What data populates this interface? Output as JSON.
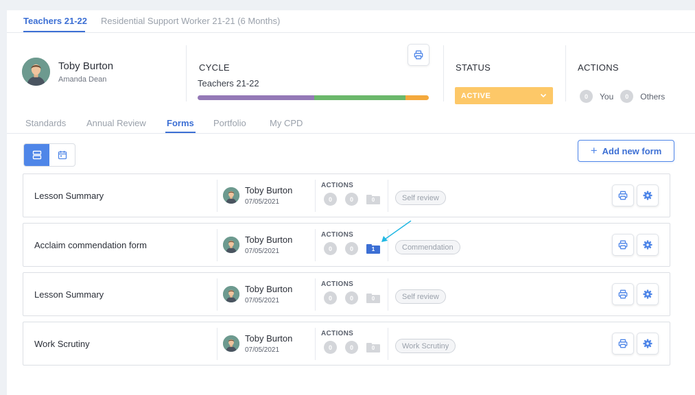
{
  "top_tabs": [
    {
      "label": "Teachers 21-22",
      "active": true
    },
    {
      "label": "Residential Support Worker 21-21 (6 Months)",
      "active": false
    }
  ],
  "profile": {
    "name": "Toby Burton",
    "subtitle": "Amanda Dean"
  },
  "cycle": {
    "label": "CYCLE",
    "value": "Teachers 21-22",
    "progress_segments": [
      {
        "fraction": 0.505,
        "color": "#9479b7"
      },
      {
        "fraction": 0.395,
        "color": "#6bb86b"
      },
      {
        "fraction": 0.1,
        "color": "#f4a93d"
      }
    ]
  },
  "status": {
    "label": "STATUS",
    "value": "ACTIVE",
    "color": "#fdc868"
  },
  "actions": {
    "label": "ACTIONS",
    "you_count": "0",
    "you_label": "You",
    "others_count": "0",
    "others_label": "Others"
  },
  "sub_tabs": [
    {
      "label": "Standards",
      "active": false
    },
    {
      "label": "Annual Review",
      "active": false
    },
    {
      "label": "Forms",
      "active": true
    },
    {
      "label": "Portfolio",
      "active": false
    },
    {
      "label": "My CPD",
      "active": false
    }
  ],
  "add_form_label": "Add new form",
  "forms": [
    {
      "title": "Lesson Summary",
      "user": "Toby Burton",
      "date": "07/05/2021",
      "actions_label": "ACTIONS",
      "count_a": "0",
      "count_b": "0",
      "folder_count": "0",
      "type": "Self review",
      "highlight": false
    },
    {
      "title": "Acclaim commendation form",
      "user": "Toby Burton",
      "date": "07/05/2021",
      "actions_label": "ACTIONS",
      "count_a": "0",
      "count_b": "0",
      "folder_count": "1",
      "type": "Commendation",
      "highlight": true
    },
    {
      "title": "Lesson Summary",
      "user": "Toby Burton",
      "date": "07/05/2021",
      "actions_label": "ACTIONS",
      "count_a": "0",
      "count_b": "0",
      "folder_count": "0",
      "type": "Self review",
      "highlight": false
    },
    {
      "title": "Work Scrutiny",
      "user": "Toby Burton",
      "date": "07/05/2021",
      "actions_label": "ACTIONS",
      "count_a": "0",
      "count_b": "0",
      "folder_count": "0",
      "type": "Work Scrutiny",
      "highlight": false
    }
  ],
  "colors": {
    "accent": "#3c6fd4",
    "accent_light": "#4f86e8",
    "annotation_arrow": "#22b8e3"
  }
}
